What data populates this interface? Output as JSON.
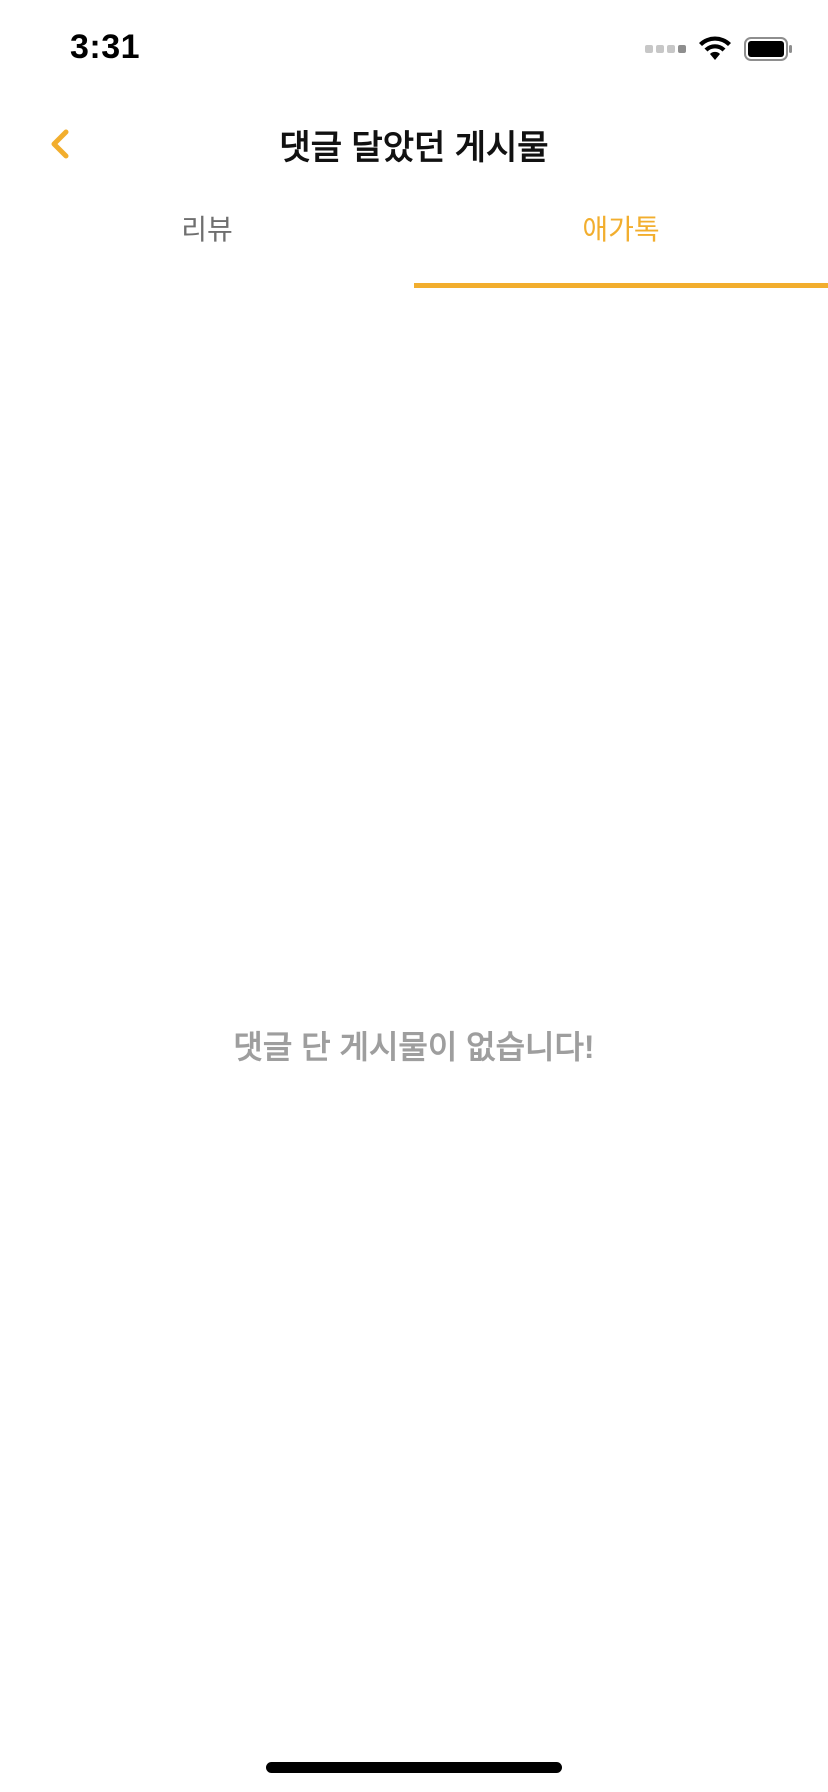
{
  "status_bar": {
    "time": "3:31",
    "icons": [
      "signal-icon",
      "wifi-icon",
      "battery-icon"
    ]
  },
  "nav": {
    "back_icon": "chevron-left-icon",
    "title": "댓글 달았던 게시물"
  },
  "tabs": [
    {
      "label": "리뷰",
      "active": false
    },
    {
      "label": "애가톡",
      "active": true
    }
  ],
  "empty_state": {
    "message": "댓글 단 게시물이 없습니다!"
  },
  "colors": {
    "accent": "#F2AE2E",
    "inactive_tab": "#6f6f6f",
    "empty_text": "#9e9e9e"
  }
}
